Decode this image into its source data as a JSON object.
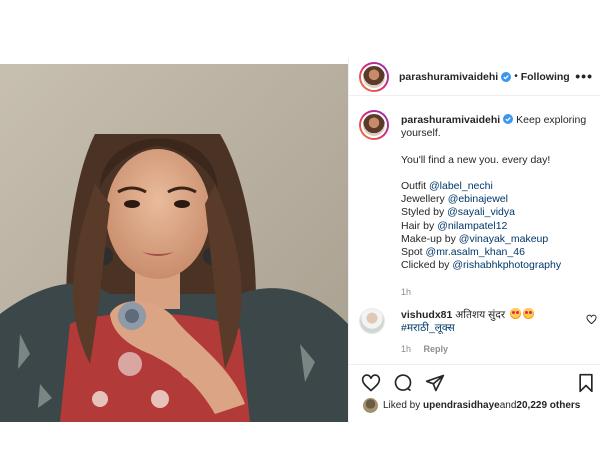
{
  "header": {
    "username": "parashuramivaidehi",
    "separator": "•",
    "follow_label": "Following",
    "more_label": "•••"
  },
  "caption": {
    "username": "parashuramivaidehi",
    "first_text": "Keep exploring yourself.",
    "line2": "You'll find a new you. every day!",
    "credits": [
      {
        "label": "Outfit ",
        "handle": "@label_nechi"
      },
      {
        "label": "Jewellery ",
        "handle": "@ebinajewel"
      },
      {
        "label": "Styled by ",
        "handle": "@sayali_vidya"
      },
      {
        "label": "Hair by ",
        "handle": "@nilampatel12"
      },
      {
        "label": "Make-up by ",
        "handle": "@vinayak_makeup"
      },
      {
        "label": "Spot ",
        "handle": "@mr.asalm_khan_46"
      },
      {
        "label": "Clicked by ",
        "handle": "@rishabhkphotography"
      }
    ],
    "time": "1h"
  },
  "comment": {
    "username": "vishudx81",
    "text": "अतिशय सुंदर",
    "hashtag": "#मराठी_लूक्स",
    "time": "1h",
    "reply_label": "Reply"
  },
  "likes": {
    "prefix": "Liked by ",
    "user": "upendrasidhaye",
    "middle": " and ",
    "count": "20,229 others"
  },
  "colors": {
    "link": "#00376b",
    "verified": "#3897f0",
    "muted": "#8e8e8e",
    "text": "#262626"
  },
  "icons": [
    "verified-icon",
    "more-icon",
    "heart-icon",
    "comment-icon",
    "share-icon",
    "bookmark-icon",
    "small-heart-icon"
  ]
}
